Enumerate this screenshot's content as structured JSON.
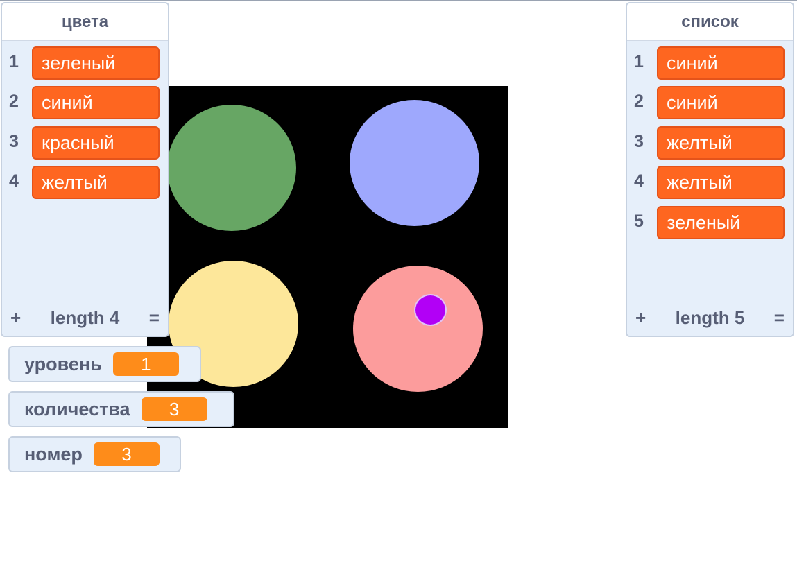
{
  "colors": {
    "list_item_bg": "#fe6620",
    "variable_value_bg": "#fe8c1a",
    "monitor_bg": "#e6effa",
    "stage_bg": "#000000",
    "sprite_green": "#67a664",
    "sprite_blue": "#9ea8fd",
    "sprite_yellow": "#fde79a",
    "sprite_red": "#fc9c9c",
    "sprite_dot": "#b200f6"
  },
  "lists": {
    "tsveta": {
      "title": "цвета",
      "items": [
        "зеленый",
        "синий",
        "красный",
        "желтый"
      ],
      "length_label": "length 4",
      "add_label": "+",
      "resize_label": "="
    },
    "spisok": {
      "title": "список",
      "items": [
        "синий",
        "синий",
        "желтый",
        "желтый",
        "зеленый"
      ],
      "length_label": "length 5",
      "add_label": "+",
      "resize_label": "="
    }
  },
  "variables": {
    "uroven": {
      "name": "уровень",
      "value": "1"
    },
    "kolichestva": {
      "name": "количества",
      "value": "3"
    },
    "nomer": {
      "name": "номер",
      "value": "3"
    }
  }
}
